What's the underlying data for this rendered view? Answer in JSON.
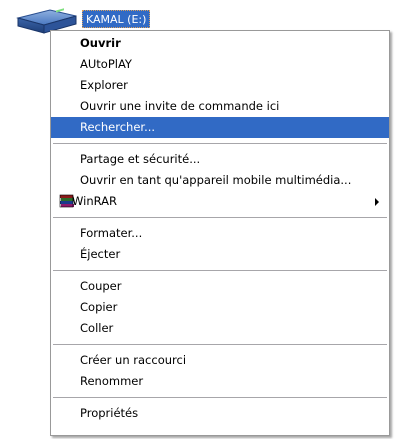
{
  "drive": {
    "label": "KAMAL (E:)",
    "icon": "removable-drive-icon"
  },
  "menu": {
    "group1": {
      "open": "Ouvrir",
      "autoplay": "AUtoPlAY",
      "explore": "Explorer",
      "cmd_here": "Ouvrir une invite de commande ici",
      "search": "Rechercher..."
    },
    "group2": {
      "sharing": "Partage et sécurité...",
      "open_mobile": "Ouvrir en tant qu'appareil mobile multimédia...",
      "winrar": "WinRAR",
      "winrar_icon": "winrar-books-icon"
    },
    "group3": {
      "format": "Formater...",
      "eject": "Éjecter"
    },
    "group4": {
      "cut": "Couper",
      "copy": "Copier",
      "paste": "Coller"
    },
    "group5": {
      "shortcut": "Créer un raccourci",
      "rename": "Renommer"
    },
    "group6": {
      "properties": "Propriétés"
    },
    "selected_item": "Rechercher...",
    "colors": {
      "highlight": "#316ac5",
      "separator": "#a7a6aa"
    }
  }
}
